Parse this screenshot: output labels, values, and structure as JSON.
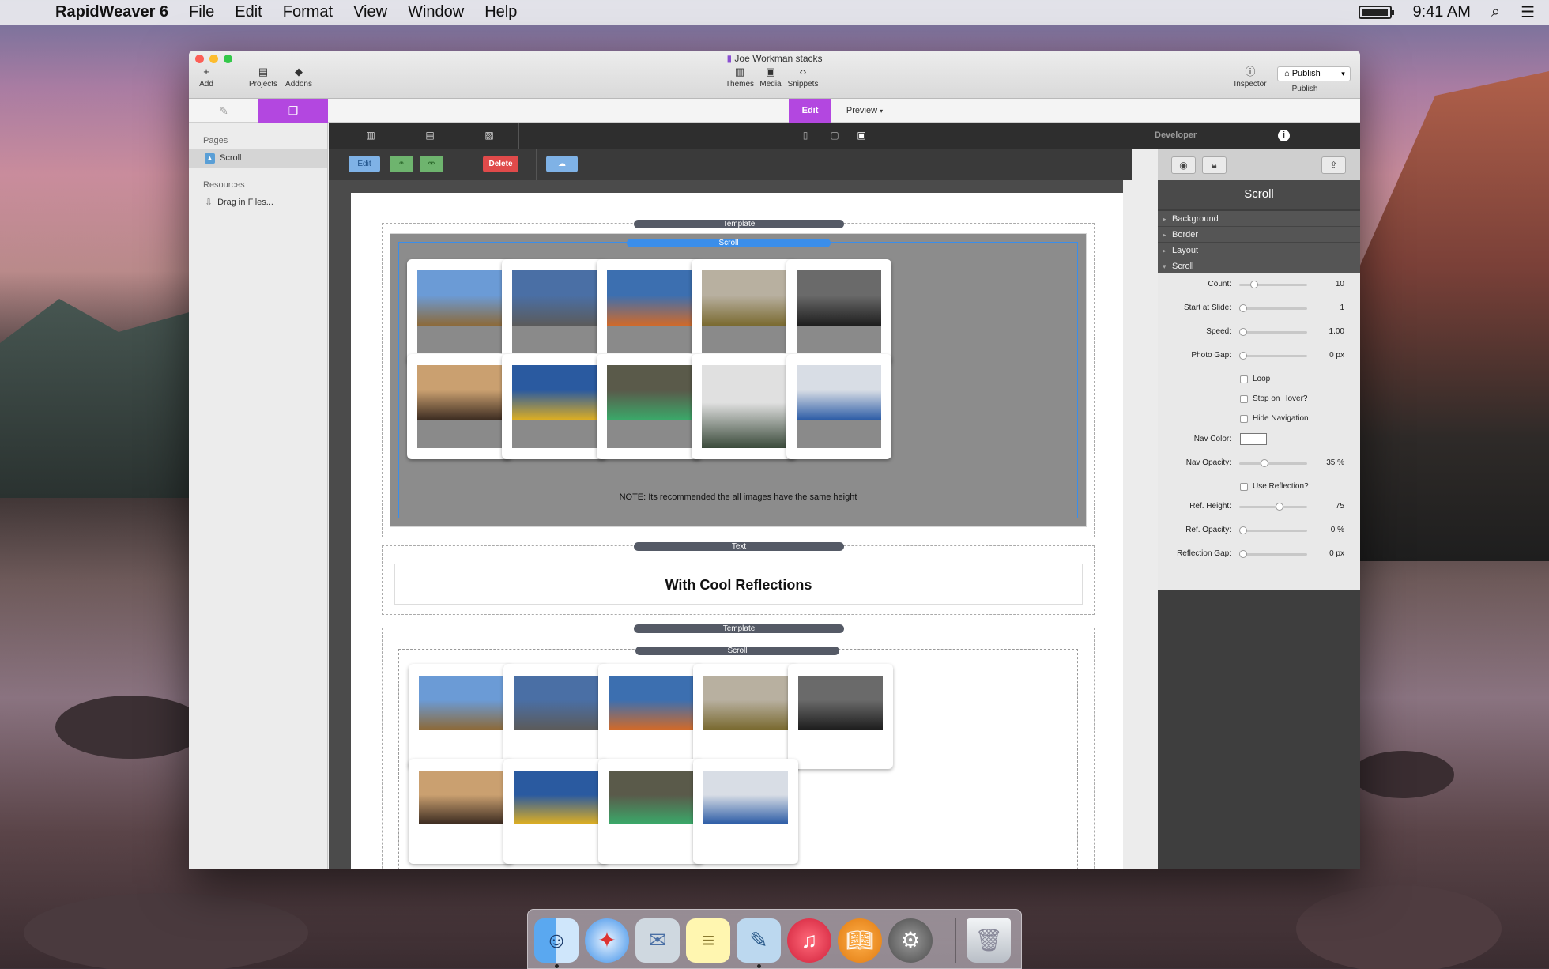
{
  "menubar": {
    "app_name": "RapidWeaver 6",
    "menus": [
      "File",
      "Edit",
      "Format",
      "View",
      "Window",
      "Help"
    ],
    "time": "9:41 AM"
  },
  "window": {
    "title": "Joe Workman stacks",
    "toolbar": {
      "add": "Add",
      "projects": "Projects",
      "addons": "Addons",
      "themes": "Themes",
      "media": "Media",
      "snippets": "Snippets",
      "inspector": "Inspector",
      "publish_button": "Publish",
      "publish_label": "Publish"
    },
    "tabs": {
      "edit": "Edit",
      "preview": "Preview"
    }
  },
  "sidebar": {
    "pages_header": "Pages",
    "pages": [
      {
        "label": "Scroll"
      }
    ],
    "resources_header": "Resources",
    "resources": [
      {
        "label": "Drag in Files..."
      }
    ]
  },
  "stacks_toolbar": {
    "edit": "Edit",
    "delete": "Delete"
  },
  "editor": {
    "block1": {
      "template_label": "Template",
      "scroll_label": "Scroll",
      "note": "NOTE: Its recommended the all images have the same height"
    },
    "block2": {
      "text_label": "Text",
      "heading": "With Cool Reflections"
    },
    "block3": {
      "template_label": "Template",
      "scroll_label": "Scroll"
    }
  },
  "photos": [
    {
      "name": "market street",
      "colors": [
        "#6b9bd6",
        "#8c6a3a"
      ]
    },
    {
      "name": "street sign",
      "colors": [
        "#4a6fa5",
        "#5b5b5b"
      ]
    },
    {
      "name": "billboard",
      "colors": [
        "#3c6fb0",
        "#d06a2a"
      ]
    },
    {
      "name": "field",
      "colors": [
        "#b8b0a0",
        "#7a6a30"
      ]
    },
    {
      "name": "cloister",
      "colors": [
        "#6a6a6a",
        "#1e1e1e"
      ]
    },
    {
      "name": "cottages",
      "colors": [
        "#caa070",
        "#3a2a20"
      ]
    },
    {
      "name": "daffodils",
      "colors": [
        "#2a5aa0",
        "#e0b020"
      ]
    },
    {
      "name": "canal boat",
      "colors": [
        "#5a5a4a",
        "#3aaa6a"
      ]
    },
    {
      "name": "canal houses",
      "colors": [
        "#e0e0e0",
        "#3a4a3a"
      ]
    },
    {
      "name": "canal sign",
      "colors": [
        "#d8dde5",
        "#2a5aa5"
      ]
    }
  ],
  "inspector": {
    "panel_title": "Developer",
    "title": "Scroll",
    "sections": [
      "Background",
      "Border",
      "Layout",
      "Scroll"
    ],
    "count": {
      "label": "Count:",
      "value": "10",
      "fraction": 0.18
    },
    "start_at_slide": {
      "label": "Start at Slide:",
      "value": "1",
      "fraction": 0.0
    },
    "speed": {
      "label": "Speed:",
      "value": "1.00",
      "fraction": 0.0
    },
    "photo_gap": {
      "label": "Photo Gap:",
      "value": "0 px",
      "fraction": 0.0
    },
    "loop": {
      "label": "Loop"
    },
    "stop_on_hover": {
      "label": "Stop on Hover?"
    },
    "hide_navigation": {
      "label": "Hide Navigation"
    },
    "nav_color": {
      "label": "Nav Color:",
      "color": "#ffffff"
    },
    "nav_opacity": {
      "label": "Nav Opacity:",
      "value": "35 %",
      "fraction": 0.35
    },
    "use_reflection": {
      "label": "Use Reflection?"
    },
    "ref_height": {
      "label": "Ref. Height:",
      "value": "75",
      "fraction": 0.6
    },
    "ref_opacity": {
      "label": "Ref. Opacity:",
      "value": "0 %",
      "fraction": 0.0
    },
    "reflection_gap": {
      "label": "Reflection Gap:",
      "value": "0 px",
      "fraction": 0.0
    }
  },
  "accent_color": "#b347e0",
  "dock": [
    "Finder",
    "Safari",
    "Mail",
    "Notes",
    "Preview",
    "iTunes",
    "iBooks",
    "System Preferences",
    "Trash"
  ]
}
